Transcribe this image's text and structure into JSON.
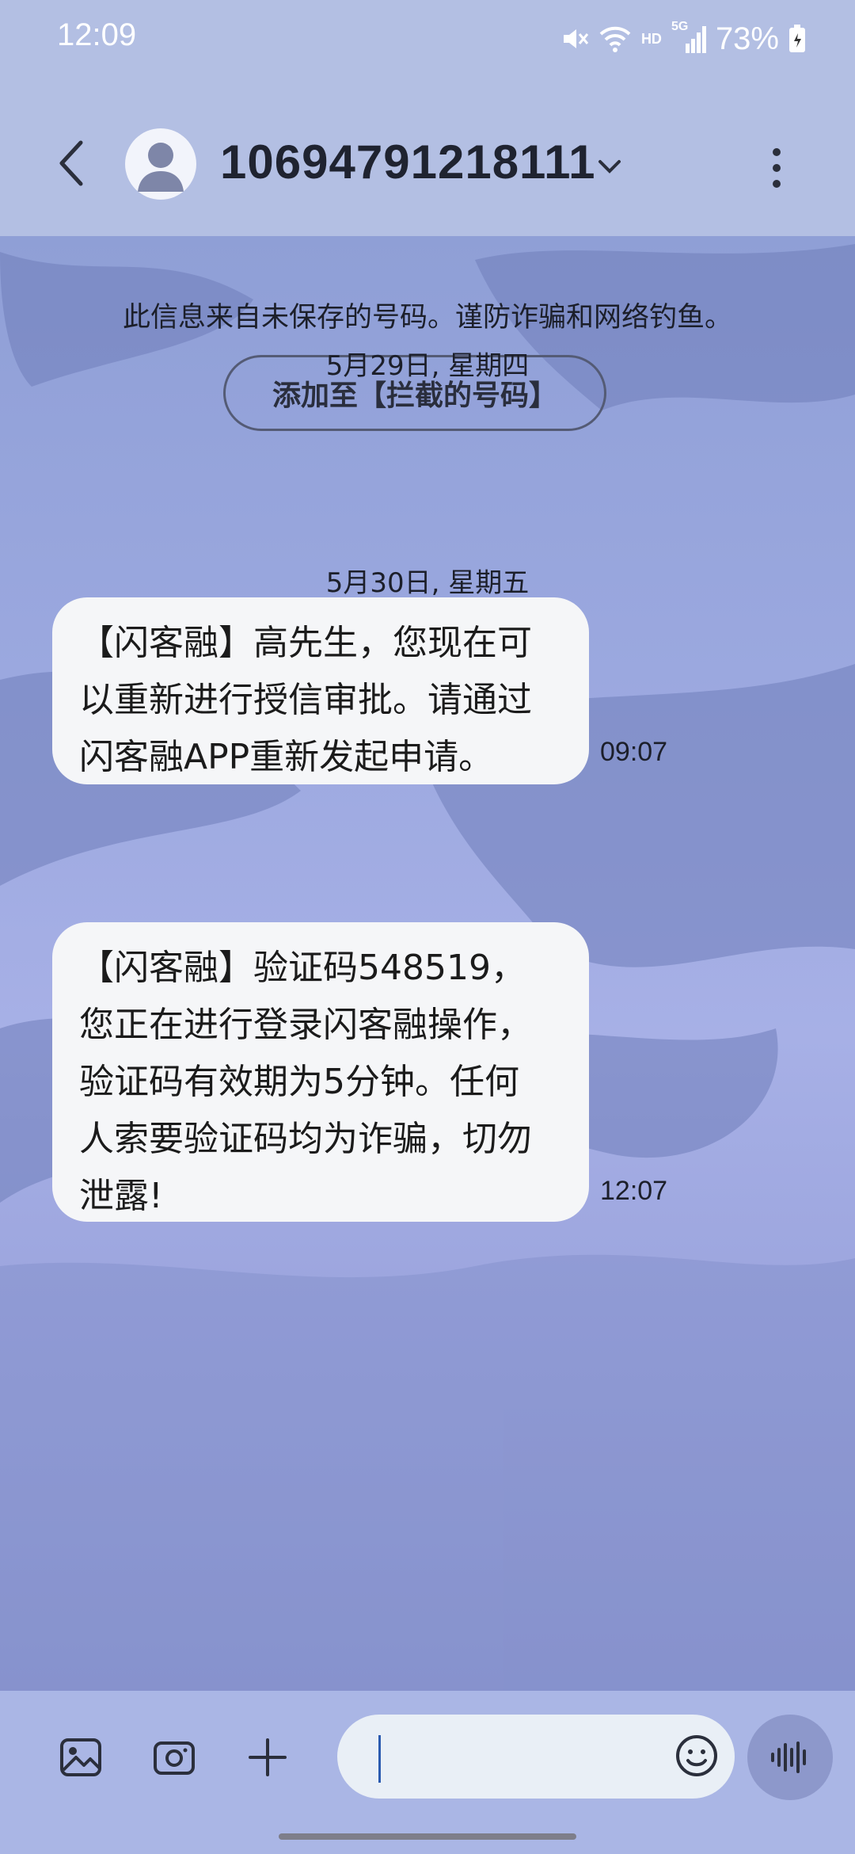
{
  "status_bar": {
    "time": "12:09",
    "battery": "73%",
    "network_label": "HD",
    "signal_label": "5G"
  },
  "header": {
    "title": "10694791218111"
  },
  "banner": {
    "warning_text": "此信息来自未保存的号码。谨防诈骗和网络钓鱼。",
    "block_button_label": "添加至【拦截的号码】"
  },
  "messages": [
    {
      "date": "5月29日, 星期四",
      "lines": [
        "【闪客融】高先生，您现在可",
        "以重新进行授信审批。请通过",
        "闪客融APP重新发起申请。"
      ],
      "time": "09:07"
    },
    {
      "date": "5月30日, 星期五",
      "lines": [
        "【闪客融】验证码548519，",
        "您正在进行登录闪客融操作，",
        "验证码有效期为5分钟。任何",
        "人索要验证码均为诈骗，切勿",
        "泄露!"
      ],
      "time": "12:07"
    }
  ],
  "composer": {
    "placeholder": ""
  },
  "icons": [
    "back-icon",
    "avatar-icon",
    "chevron-down-icon",
    "more-options-icon",
    "gallery-icon",
    "camera-icon",
    "plus-icon",
    "emoji-icon",
    "voice-icon",
    "mute-icon",
    "wifi-icon",
    "signal-icon",
    "battery-icon"
  ],
  "colors": {
    "header_bg": "#b3bfe3",
    "bubble_bg": "#f5f6f8",
    "input_bg": "#e9eff6",
    "voice_btn_bg": "#8d98cb"
  }
}
